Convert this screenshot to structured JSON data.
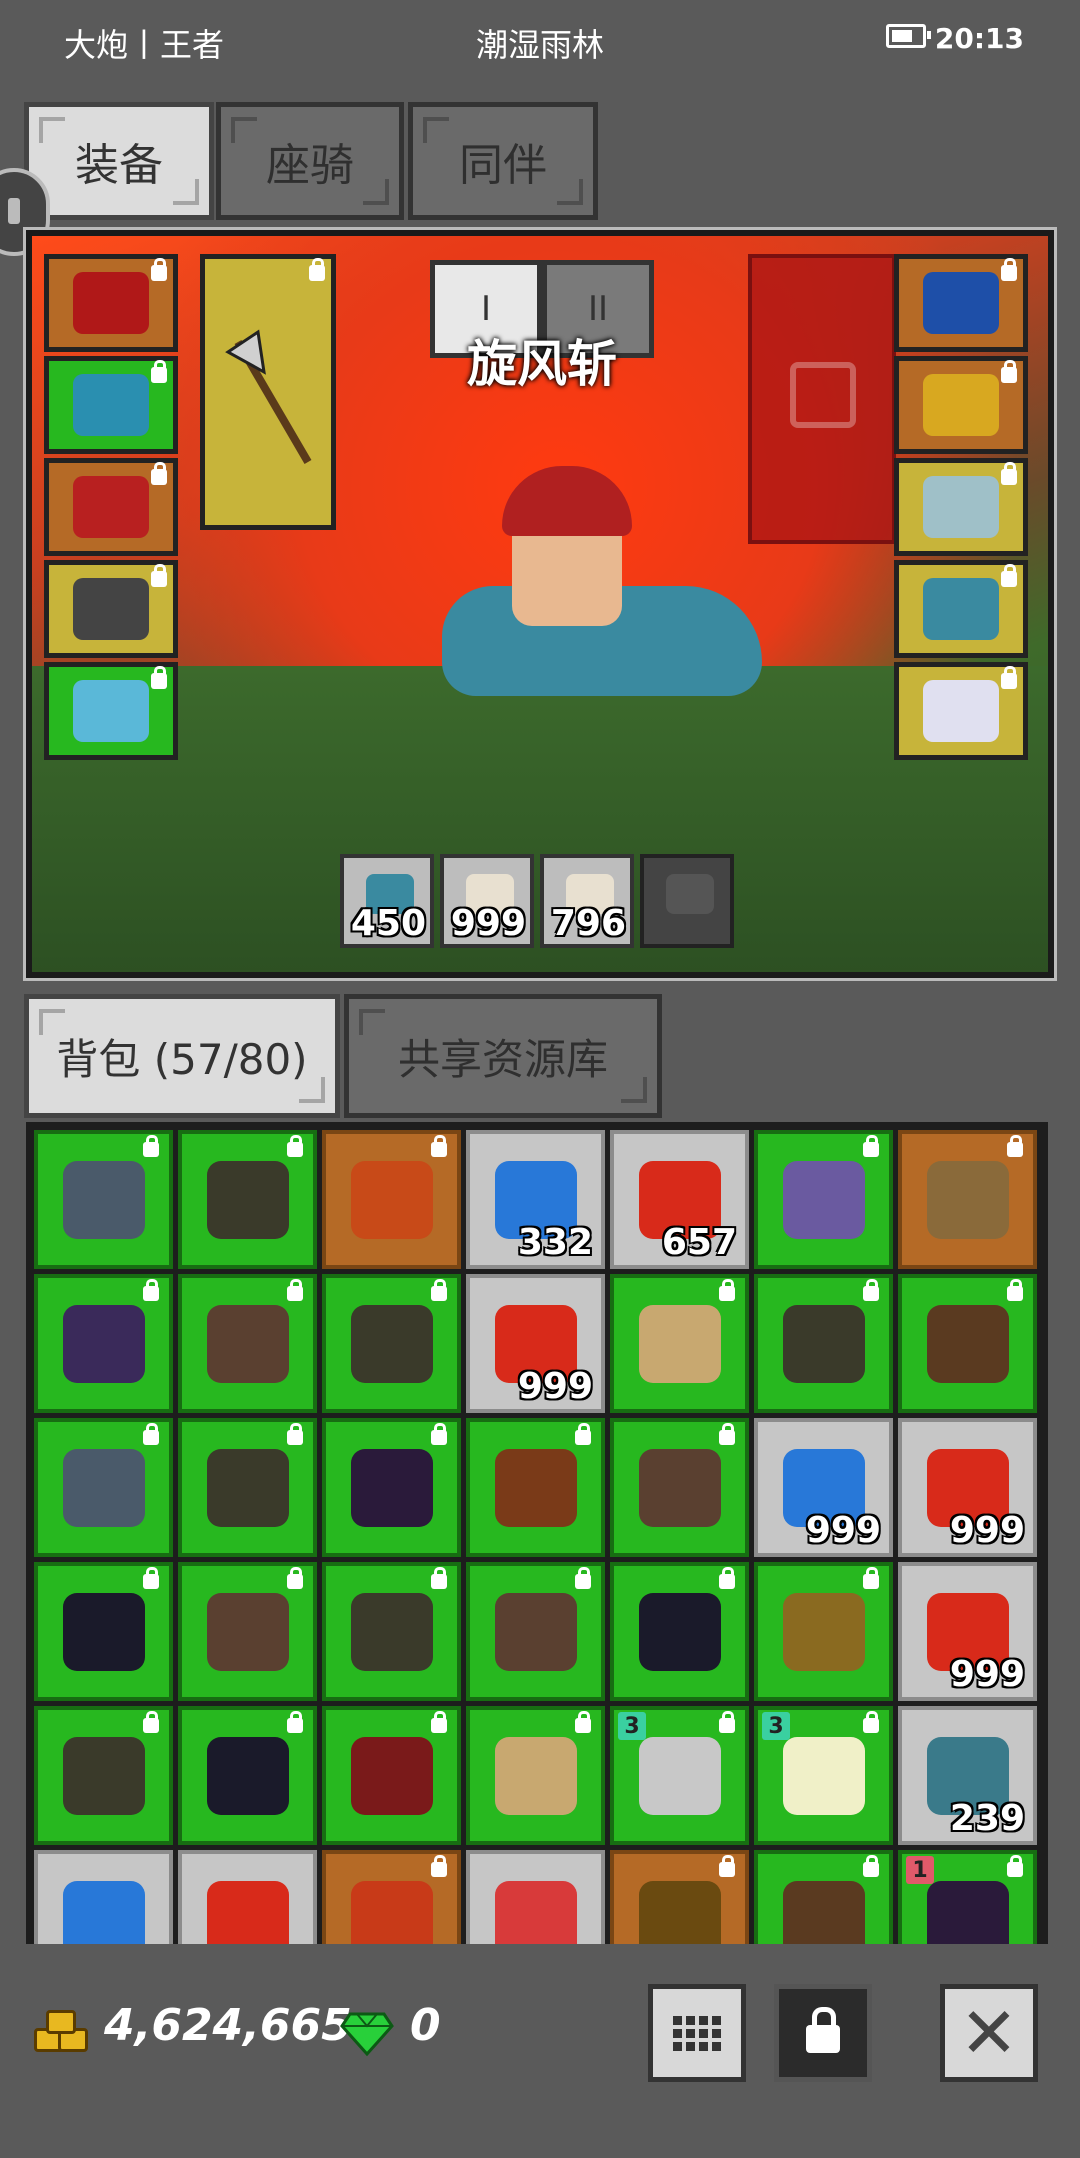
{
  "status_bar": {
    "left": "大炮丨王者",
    "center": "潮湿雨林",
    "time": "20:13",
    "battery_level": 0.7
  },
  "top_tabs": [
    {
      "label": "装备",
      "active": true
    },
    {
      "label": "座骑",
      "active": false
    },
    {
      "label": "同伴",
      "active": false
    }
  ],
  "equipment": {
    "skill_tabs": [
      "I",
      "II"
    ],
    "skill_name": "旋风斩",
    "left_slots": [
      {
        "name": "helmet",
        "color": "brown",
        "icon": "red-hat-icon",
        "icon_color": "#b01818"
      },
      {
        "name": "armor",
        "color": "green",
        "icon": "blue-armor-icon",
        "icon_color": "#2a8fb0"
      },
      {
        "name": "gloves",
        "color": "brown",
        "icon": "red-gloves-icon",
        "icon_color": "#b82020"
      },
      {
        "name": "boots",
        "color": "yellow",
        "icon": "boots-icon",
        "icon_color": "#444444"
      },
      {
        "name": "belt",
        "color": "green",
        "icon": "belt-icon",
        "icon_color": "#5ab8d8"
      }
    ],
    "weapon_slot": {
      "color": "yellow",
      "icon": "halberd-icon"
    },
    "right_slots": [
      {
        "name": "necklace",
        "color": "brown",
        "icon": "horned-amulet-icon",
        "icon_color": "#1e4fa8"
      },
      {
        "name": "earring",
        "color": "brown",
        "icon": "gold-earring-icon",
        "icon_color": "#d8a820"
      },
      {
        "name": "ring",
        "color": "yellow",
        "icon": "ring-icon",
        "icon_color": "#9fc0c8"
      },
      {
        "name": "mount-card",
        "color": "yellow",
        "icon": "raptor-card-icon",
        "icon_color": "#3a8aa0"
      },
      {
        "name": "pet-card",
        "color": "yellow",
        "icon": "cat-card-icon",
        "icon_color": "#e0e0f0"
      }
    ],
    "quick_items": [
      {
        "icon": "fish-icon",
        "count": "450"
      },
      {
        "icon": "potion-icon",
        "count": "999"
      },
      {
        "icon": "potion-icon",
        "count": "796"
      },
      {
        "icon": "empty-slot-icon",
        "count": ""
      }
    ]
  },
  "bag_tabs": [
    {
      "label": "背包 (57/80)",
      "active": true
    },
    {
      "label": "共享资源库",
      "active": false
    }
  ],
  "inventory": [
    {
      "bg": "green",
      "icon": "gauntlet-icon",
      "c": "#4a5a6a",
      "lock": true,
      "count": ""
    },
    {
      "bg": "green",
      "icon": "helmet-icon",
      "c": "#3a3a2a",
      "lock": true,
      "count": ""
    },
    {
      "bg": "brown",
      "icon": "flame-armor-icon",
      "c": "#c84a18",
      "lock": true,
      "count": ""
    },
    {
      "bg": "gray",
      "icon": "blue-feather-icon",
      "c": "#2878d8",
      "lock": false,
      "count": "332"
    },
    {
      "bg": "gray",
      "icon": "red-feather-icon",
      "c": "#d82a1a",
      "lock": false,
      "count": "657"
    },
    {
      "bg": "green",
      "icon": "purple-sword-icon",
      "c": "#6a5aa0",
      "lock": true,
      "count": ""
    },
    {
      "bg": "brown",
      "icon": "axe-icon",
      "c": "#8a6a3a",
      "lock": true,
      "count": ""
    },
    {
      "bg": "green",
      "icon": "purple-gloves-icon",
      "c": "#3a2a5a",
      "lock": true,
      "count": ""
    },
    {
      "bg": "green",
      "icon": "horned-mask-icon",
      "c": "#5a4030",
      "lock": true,
      "count": ""
    },
    {
      "bg": "green",
      "icon": "helmet-icon",
      "c": "#3a3a2a",
      "lock": true,
      "count": ""
    },
    {
      "bg": "gray",
      "icon": "red-feather-icon",
      "c": "#d82a1a",
      "lock": false,
      "count": "999"
    },
    {
      "bg": "green",
      "icon": "double-axe-icon",
      "c": "#c8a870",
      "lock": true,
      "count": ""
    },
    {
      "bg": "green",
      "icon": "helmet-icon",
      "c": "#3a3a2a",
      "lock": true,
      "count": ""
    },
    {
      "bg": "green",
      "icon": "leather-armor-icon",
      "c": "#5a3a20",
      "lock": true,
      "count": ""
    },
    {
      "bg": "green",
      "icon": "gauntlet-icon",
      "c": "#4a5a6a",
      "lock": true,
      "count": ""
    },
    {
      "bg": "green",
      "icon": "helmet-icon",
      "c": "#3a3a2a",
      "lock": true,
      "count": ""
    },
    {
      "bg": "green",
      "icon": "purple-hat-icon",
      "c": "#2a1a3a",
      "lock": true,
      "count": ""
    },
    {
      "bg": "green",
      "icon": "brown-vest-icon",
      "c": "#7a3a18",
      "lock": true,
      "count": ""
    },
    {
      "bg": "green",
      "icon": "horned-mask-icon",
      "c": "#5a4030",
      "lock": true,
      "count": ""
    },
    {
      "bg": "gray",
      "icon": "blue-feather-icon",
      "c": "#2878d8",
      "lock": false,
      "count": "999"
    },
    {
      "bg": "gray",
      "icon": "red-feather-icon",
      "c": "#d82a1a",
      "lock": false,
      "count": "999"
    },
    {
      "bg": "green",
      "icon": "horned-helmet-icon",
      "c": "#1a1a2a",
      "lock": true,
      "count": ""
    },
    {
      "bg": "green",
      "icon": "horned-mask-icon",
      "c": "#5a4030",
      "lock": true,
      "count": ""
    },
    {
      "bg": "green",
      "icon": "helmet-icon",
      "c": "#3a3a2a",
      "lock": true,
      "count": ""
    },
    {
      "bg": "green",
      "icon": "horned-mask-icon",
      "c": "#5a4030",
      "lock": true,
      "count": ""
    },
    {
      "bg": "green",
      "icon": "horned-helmet-icon",
      "c": "#1a1a2a",
      "lock": true,
      "count": ""
    },
    {
      "bg": "green",
      "icon": "gold-helmet-icon",
      "c": "#8a6a20",
      "lock": true,
      "count": ""
    },
    {
      "bg": "gray",
      "icon": "red-feather-icon",
      "c": "#d82a1a",
      "lock": false,
      "count": "999"
    },
    {
      "bg": "green",
      "icon": "helmet-icon",
      "c": "#3a3a2a",
      "lock": true,
      "count": ""
    },
    {
      "bg": "green",
      "icon": "horned-helmet-icon",
      "c": "#1a1a2a",
      "lock": true,
      "count": ""
    },
    {
      "bg": "green",
      "icon": "red-robe-icon",
      "c": "#7a1a1a",
      "lock": true,
      "count": ""
    },
    {
      "bg": "green",
      "icon": "double-axe-icon",
      "c": "#c8a870",
      "lock": true,
      "count": ""
    },
    {
      "bg": "green",
      "icon": "steel-boots-icon",
      "c": "#c8c8c8",
      "lock": true,
      "count": "",
      "level": "3"
    },
    {
      "bg": "green",
      "icon": "antler-crest-icon",
      "c": "#f0f0c8",
      "lock": true,
      "count": "",
      "level": "3"
    },
    {
      "bg": "gray",
      "icon": "fish-icon",
      "c": "#3a7a8a",
      "lock": false,
      "count": "239"
    },
    {
      "bg": "gray",
      "icon": "blue-feather-icon",
      "c": "#2878d8",
      "lock": false,
      "count": ""
    },
    {
      "bg": "gray",
      "icon": "red-feather-icon",
      "c": "#d82a1a",
      "lock": false,
      "count": ""
    },
    {
      "bg": "brown",
      "icon": "demon-mask-icon",
      "c": "#c83a18",
      "lock": true,
      "count": ""
    },
    {
      "bg": "gray",
      "icon": "potion-icon",
      "c": "#d83a3a",
      "lock": false,
      "count": ""
    },
    {
      "bg": "brown",
      "icon": "treasure-icon",
      "c": "#6a4a10",
      "lock": true,
      "count": ""
    },
    {
      "bg": "green",
      "icon": "leather-armor-icon",
      "c": "#5a3a20",
      "lock": true,
      "count": ""
    },
    {
      "bg": "green",
      "icon": "purple-hat-icon",
      "c": "#2a1a3a",
      "lock": true,
      "count": "",
      "level": "1"
    }
  ],
  "currency": {
    "gold": "4,624,665",
    "gems": "0"
  },
  "icons": {
    "gold": "gold-coins-icon",
    "gem": "green-gem-icon",
    "sort": "grid-sort-icon",
    "lock": "lock-icon",
    "close": "close-icon"
  }
}
